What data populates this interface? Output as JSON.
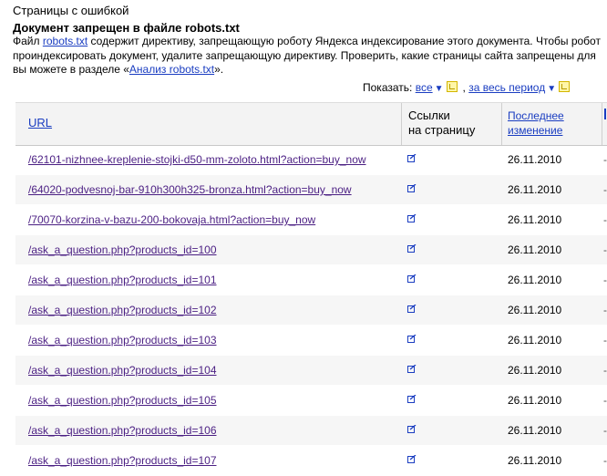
{
  "breadcrumb": "Страницы с ошибкой",
  "heading": "Документ запрещен в файле robots.txt",
  "description": {
    "line1_before": "Файл ",
    "line1_link": "robots.txt",
    "line1_after": " содержит директиву, запрещающую роботу Яндекса индексирование этого документа. Чтобы робот",
    "line2": "проиндексировать документ, удалите запрещающую директиву. Проверить, какие страницы сайта запрещены для",
    "line3_before": "вы можете в разделе «",
    "line3_link": "Анализ robots.txt",
    "line3_after": "»."
  },
  "filter": {
    "label": "Показать:",
    "all_label": "все",
    "period_label": "за весь период",
    "separator": ","
  },
  "table": {
    "col_url": "URL",
    "col_links_line1": "Ссылки",
    "col_links_line2": "на страницу",
    "col_date_line1": "Последнее",
    "col_date_line2": "изменение",
    "rows": [
      {
        "url": "/62101-nizhnee-kreplenie-stojki-d50-mm-zoloto.html?action=buy_now",
        "date": "26.11.2010",
        "dash": "-"
      },
      {
        "url": "/64020-podvesnoj-bar-910h300h325-bronza.html?action=buy_now",
        "date": "26.11.2010",
        "dash": "-"
      },
      {
        "url": "/70070-korzina-v-bazu-200-bokovaja.html?action=buy_now",
        "date": "26.11.2010",
        "dash": "-"
      },
      {
        "url": "/ask_a_question.php?products_id=100",
        "date": "26.11.2010",
        "dash": "-"
      },
      {
        "url": "/ask_a_question.php?products_id=101",
        "date": "26.11.2010",
        "dash": "-"
      },
      {
        "url": "/ask_a_question.php?products_id=102",
        "date": "26.11.2010",
        "dash": "-"
      },
      {
        "url": "/ask_a_question.php?products_id=103",
        "date": "26.11.2010",
        "dash": "-"
      },
      {
        "url": "/ask_a_question.php?products_id=104",
        "date": "26.11.2010",
        "dash": "-"
      },
      {
        "url": "/ask_a_question.php?products_id=105",
        "date": "26.11.2010",
        "dash": "-"
      },
      {
        "url": "/ask_a_question.php?products_id=106",
        "date": "26.11.2010",
        "dash": "-"
      },
      {
        "url": "/ask_a_question.php?products_id=107",
        "date": "26.11.2010",
        "dash": "-"
      }
    ]
  },
  "icons": {
    "row_icon": "edit-square-icon",
    "hint_icon": "help-hint-icon",
    "caret_icon": "caret-down-icon"
  },
  "colors": {
    "link": "#1a3dc1",
    "visited_link": "#4b1f83",
    "row_alt": "#f6f6f6",
    "header_bg": "#f3f3f3"
  }
}
